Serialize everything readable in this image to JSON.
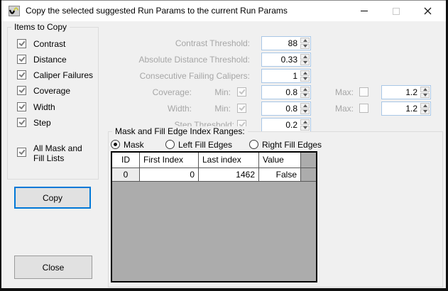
{
  "window": {
    "title": "Copy the selected suggested Run Params to the current Run Params",
    "icons": {
      "app": "waveform-icon",
      "minimize": "minimize-icon",
      "maximize": "maximize-icon",
      "close": "close-icon"
    }
  },
  "items_to_copy": {
    "legend": "Items to Copy",
    "items": [
      {
        "label": "Contrast",
        "checked": true
      },
      {
        "label": "Distance",
        "checked": true
      },
      {
        "label": "Caliper Failures",
        "checked": true
      },
      {
        "label": "Coverage",
        "checked": true
      },
      {
        "label": "Width",
        "checked": true
      },
      {
        "label": "Step",
        "checked": true
      },
      {
        "label": "All Mask and Fill Lists",
        "checked": true
      }
    ]
  },
  "params": {
    "rows": [
      {
        "label": "Contrast Threshold:",
        "value": "88"
      },
      {
        "label": "Absolute Distance Threshold:",
        "value": "0.33"
      },
      {
        "label": "Consecutive Failing Calipers:",
        "value": "1"
      }
    ],
    "coverage": {
      "label": "Coverage:",
      "min_label": "Min:",
      "min_checked": true,
      "min_value": "0.8",
      "max_label": "Max:",
      "max_checked": false,
      "max_value": "1.2"
    },
    "width": {
      "label": "Width:",
      "min_label": "Min:",
      "min_checked": true,
      "min_value": "0.8",
      "max_label": "Max:",
      "max_checked": false,
      "max_value": "1.2"
    },
    "step": {
      "label": "Step Threshold:",
      "checked": true,
      "value": "0.2"
    }
  },
  "mask_group": {
    "legend": "Mask and Fill Edge Index Ranges:",
    "radios": [
      {
        "label": "Mask",
        "selected": true
      },
      {
        "label": "Left Fill Edges",
        "selected": false
      },
      {
        "label": "Right Fill Edges",
        "selected": false
      }
    ],
    "table": {
      "columns": [
        "ID",
        "First Index",
        "Last index",
        "Value"
      ],
      "rows": [
        [
          "0",
          "0",
          "1462",
          "False"
        ]
      ]
    }
  },
  "buttons": {
    "copy": "Copy",
    "close": "Close"
  },
  "colors": {
    "accent": "#0078D7",
    "window_bg": "#F0F0F0",
    "titlebar_bg": "#FFFFFF",
    "spinner_border": "#A9C7E6",
    "disabled_text": "#A6A6A6",
    "table_empty_fill": "#ACACAC"
  }
}
